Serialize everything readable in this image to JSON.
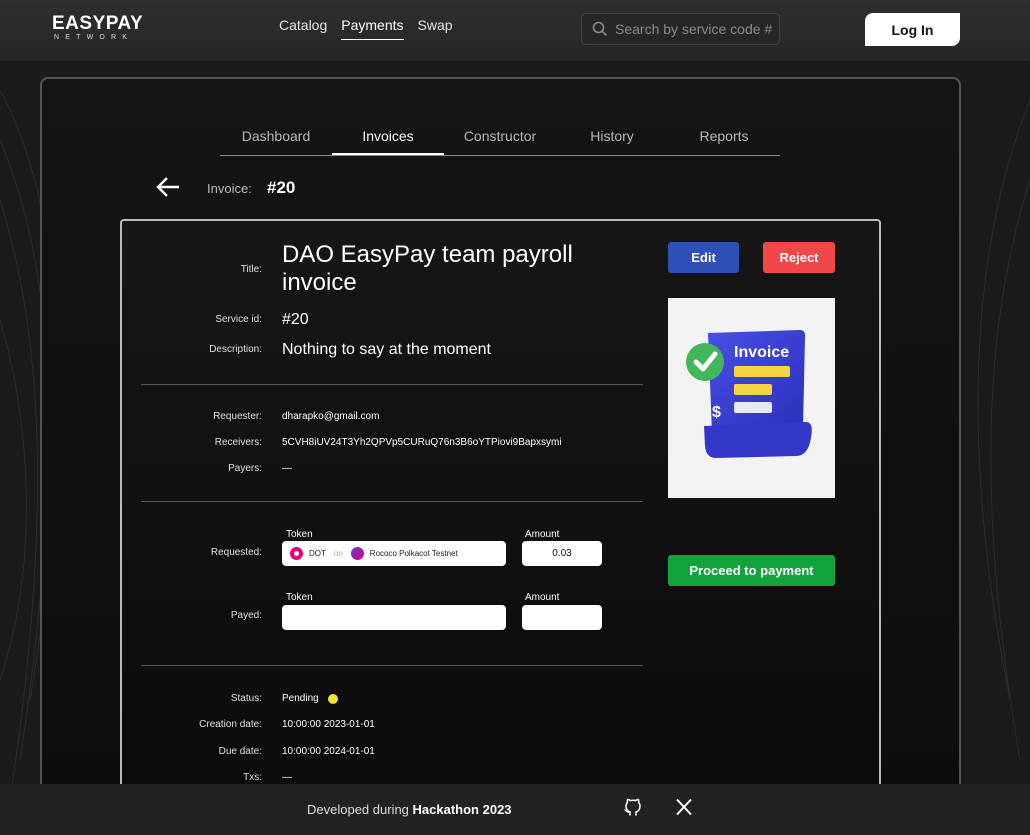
{
  "header": {
    "logo_main": "EASYPAY",
    "logo_sub": "NETWORK",
    "nav": [
      "Catalog",
      "Payments",
      "Swap"
    ],
    "active_nav": "Payments",
    "search_placeholder": "Search by service code #",
    "login_label": "Log In"
  },
  "tabs": [
    {
      "label": "Dashboard"
    },
    {
      "label": "Invoices"
    },
    {
      "label": "Constructor"
    },
    {
      "label": "History"
    },
    {
      "label": "Reports"
    }
  ],
  "active_tab": "Invoices",
  "invoice_header": {
    "label": "Invoice:",
    "number": "#20"
  },
  "details": {
    "title_label": "Title:",
    "title": "DAO EasyPay team payroll invoice",
    "service_id_label": "Service id:",
    "service_id": "#20",
    "description_label": "Description:",
    "description": "Nothing to say at the moment",
    "requester_label": "Requester:",
    "requester": "dharapko@gmail.com",
    "receivers_label": "Receivers:",
    "receivers": "5CVH8iUV24T3Yh2QPVp5CURuQ76n3B6oYTPiovi9Bapxsymi",
    "payers_label": "Payers:",
    "payers": "—"
  },
  "requested": {
    "label": "Requested:",
    "token_header": "Token",
    "amount_header": "Amount",
    "token": "DOT",
    "on": "on",
    "network": "Rococo Polkacot Testnet",
    "amount": "0.03"
  },
  "payed": {
    "label": "Payed:",
    "token_header": "Token",
    "amount_header": "Amount",
    "token": "",
    "amount": ""
  },
  "status": {
    "status_label": "Status:",
    "status": "Pending",
    "status_color": "#f2e135",
    "creation_label": "Creation date:",
    "creation_date": "10:00:00 2023-01-01",
    "due_label": "Due date:",
    "due_date": "10:00:00 2024-01-01",
    "txs_label": "Txs:",
    "txs": "—"
  },
  "actions": {
    "edit": "Edit",
    "reject": "Reject",
    "proceed": "Proceed to payment"
  },
  "image": {
    "text": "Invoice"
  },
  "footer": {
    "prefix": "Developed during",
    "event": "Hackathon 2023"
  },
  "colors": {
    "edit": "#2c4fb8",
    "reject": "#f04848",
    "proceed": "#13a33c"
  }
}
